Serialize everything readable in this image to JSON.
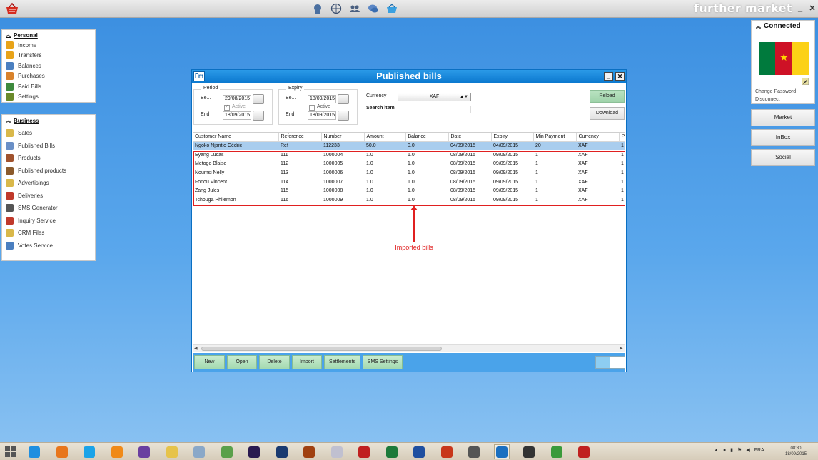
{
  "topbar": {
    "brand": "further market"
  },
  "left_panels": {
    "personal": {
      "title": "Personal",
      "items": [
        {
          "label": "Income",
          "icon": "coins-icon",
          "color": "#e8a318"
        },
        {
          "label": "Transfers",
          "icon": "money-transfer-icon",
          "color": "#e8a318"
        },
        {
          "label": "Balances",
          "icon": "scales-icon",
          "color": "#4a7fc0"
        },
        {
          "label": "Purchases",
          "icon": "shop-icon",
          "color": "#d9822b"
        },
        {
          "label": "Paid Bills",
          "icon": "paid-bill-icon",
          "color": "#3d8a3d"
        },
        {
          "label": "Settings",
          "icon": "gears-icon",
          "color": "#6a8a2a"
        }
      ]
    },
    "business": {
      "title": "Business",
      "items": [
        {
          "label": "Sales",
          "icon": "sales-icon",
          "color": "#d9b84a"
        },
        {
          "label": "Published Bills",
          "icon": "published-bills-icon",
          "color": "#6a8fc6"
        },
        {
          "label": "Products",
          "icon": "products-icon",
          "color": "#a0522d"
        },
        {
          "label": "Published products",
          "icon": "published-products-icon",
          "color": "#8b5a2b"
        },
        {
          "label": "Advertisings",
          "icon": "advertising-icon",
          "color": "#d9b84a"
        },
        {
          "label": "Deliveries",
          "icon": "deliveries-icon",
          "color": "#c0392b"
        },
        {
          "label": "SMS Generator",
          "icon": "sms-icon",
          "color": "#555555"
        },
        {
          "label": "Inquiry Service",
          "icon": "inquiry-icon",
          "color": "#c0392b"
        },
        {
          "label": "CRM Files",
          "icon": "crm-files-icon",
          "color": "#d9b84a"
        },
        {
          "label": "Votes Service",
          "icon": "votes-icon",
          "color": "#4a7fc0"
        }
      ]
    }
  },
  "right_panel": {
    "status": "Connected",
    "change_password": "Change Password",
    "disconnect": "Disconnect",
    "flag_colors": [
      "#007a3d",
      "#ce1126",
      "#fcd116"
    ],
    "buttons": [
      "Market",
      "InBox",
      "Social"
    ]
  },
  "window": {
    "title": "Published bills",
    "period": {
      "label": "Period",
      "begin_label": "Be...",
      "begin_value": "29/08/2015",
      "active_label": "Active",
      "active_checked": true,
      "end_label": "End",
      "end_value": "18/09/2015"
    },
    "expiry": {
      "label": "Expiry",
      "begin_label": "Be...",
      "begin_value": "18/09/2015",
      "active_label": "Active",
      "active_checked": false,
      "end_label": "End",
      "end_value": "18/09/2015"
    },
    "currency_label": "Currency",
    "currency_value": "XAF",
    "search_label": "Search item",
    "search_value": "",
    "reload_label": "Reload",
    "download_label": "Download",
    "table": {
      "columns": [
        "Customer Name",
        "Reference",
        "Number",
        "Amount",
        "Balance",
        "Date",
        "Expiry",
        "Min Payment",
        "Currency",
        "P"
      ],
      "rows": [
        [
          "Ngoko Njantio Cédric",
          "Ref",
          "112233",
          "50.0",
          "0.0",
          "04/09/2015",
          "04/09/2015",
          "20",
          "XAF",
          "1"
        ],
        [
          "Eyang Lucas",
          "111",
          "1000004",
          "1.0",
          "1.0",
          "08/09/2015",
          "09/09/2015",
          "1",
          "XAF",
          "1"
        ],
        [
          "Metogo Blaise",
          "112",
          "1000005",
          "1.0",
          "1.0",
          "08/09/2015",
          "09/09/2015",
          "1",
          "XAF",
          "1"
        ],
        [
          "Noumsi Nelly",
          "113",
          "1000006",
          "1.0",
          "1.0",
          "08/09/2015",
          "09/09/2015",
          "1",
          "XAF",
          "1"
        ],
        [
          "Fonou Vincent",
          "114",
          "1000007",
          "1.0",
          "1.0",
          "08/09/2015",
          "09/09/2015",
          "1",
          "XAF",
          "1"
        ],
        [
          "Zang Jules",
          "115",
          "1000008",
          "1.0",
          "1.0",
          "08/09/2015",
          "09/09/2015",
          "1",
          "XAF",
          "1"
        ],
        [
          "Tchouga Philemon",
          "116",
          "1000009",
          "1.0",
          "1.0",
          "08/09/2015",
          "09/09/2015",
          "1",
          "XAF",
          "1"
        ]
      ]
    },
    "annotation": "Imported bills",
    "bottom_buttons": [
      "New",
      "Open",
      "Delete",
      "Import",
      "Settlements",
      "SMS Settings"
    ]
  },
  "taskbar": {
    "apps": [
      "internet-explorer-icon",
      "firefox-icon",
      "skype-icon",
      "vlc-icon",
      "visual-studio-icon",
      "file-explorer-icon",
      "notepad-icon",
      "image-viewer-icon",
      "after-effects-icon",
      "photoshop-icon",
      "illustrator-icon",
      "calculator-icon",
      "acrobat-icon",
      "excel-icon",
      "word-icon",
      "powerpoint-icon",
      "photo-app-icon",
      "further-market-icon",
      "remote-desktop-icon",
      "network-app-icon",
      "shield-app-icon"
    ],
    "language": "FRA",
    "time": "08:30",
    "date": "18/09/2015"
  }
}
